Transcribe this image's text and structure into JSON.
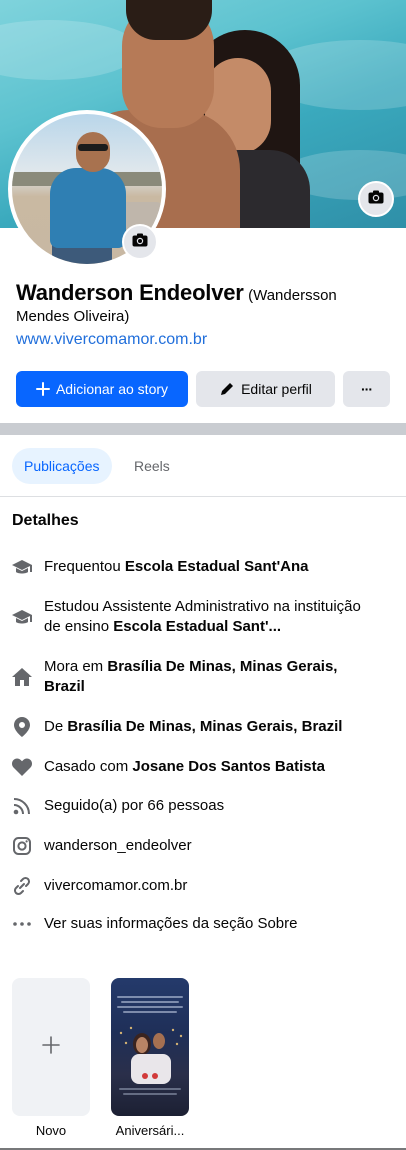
{
  "profile": {
    "name": "Wanderson Endeolver",
    "alt_name_part1": "(Wandersson",
    "alt_name_part2": "Mendes Oliveira)",
    "website": "www.vivercomamor.com.br"
  },
  "actions": {
    "add_story": "Adicionar ao story",
    "edit_profile": "Editar perfil",
    "more": "···"
  },
  "tabs": [
    {
      "label": "Publicações",
      "active": true
    },
    {
      "label": "Reels",
      "active": false
    }
  ],
  "details": {
    "title": "Detalhes",
    "items": [
      {
        "icon": "graduation-cap-icon",
        "prefix": "Frequentou ",
        "bold": "Escola Estadual Sant'Ana",
        "suffix": ""
      },
      {
        "icon": "graduation-cap-icon",
        "prefix": "Estudou Assistente Administrativo na instituição de ensino ",
        "bold": "Escola Estadual Sant'...",
        "suffix": ""
      },
      {
        "icon": "home-icon",
        "prefix": "Mora em ",
        "bold": "Brasília De Minas, Minas Gerais, Brazil",
        "suffix": ""
      },
      {
        "icon": "location-pin-icon",
        "prefix": "De ",
        "bold": "Brasília De Minas, Minas Gerais, Brazil",
        "suffix": ""
      },
      {
        "icon": "heart-icon",
        "prefix": "Casado com ",
        "bold": "Josane Dos Santos Batista",
        "suffix": ""
      },
      {
        "icon": "rss-icon",
        "prefix": "Seguido(a) por 66 pessoas",
        "bold": "",
        "suffix": ""
      },
      {
        "icon": "instagram-icon",
        "prefix": "wanderson_endeolver",
        "bold": "",
        "suffix": ""
      },
      {
        "icon": "link-icon",
        "prefix": "vivercomamor.com.br",
        "bold": "",
        "suffix": ""
      },
      {
        "icon": "more-dots-icon",
        "prefix": "Ver suas informações da seção Sobre",
        "bold": "",
        "suffix": ""
      }
    ]
  },
  "highlights": {
    "new_label": "Novo",
    "anniversary_label": "Aniversári..."
  },
  "colors": {
    "primary": "#0866ff",
    "link": "#216fdb",
    "secondary_button": "#e4e6eb",
    "tab_active_bg": "#e7f3ff",
    "icon_gray": "#65676b"
  }
}
